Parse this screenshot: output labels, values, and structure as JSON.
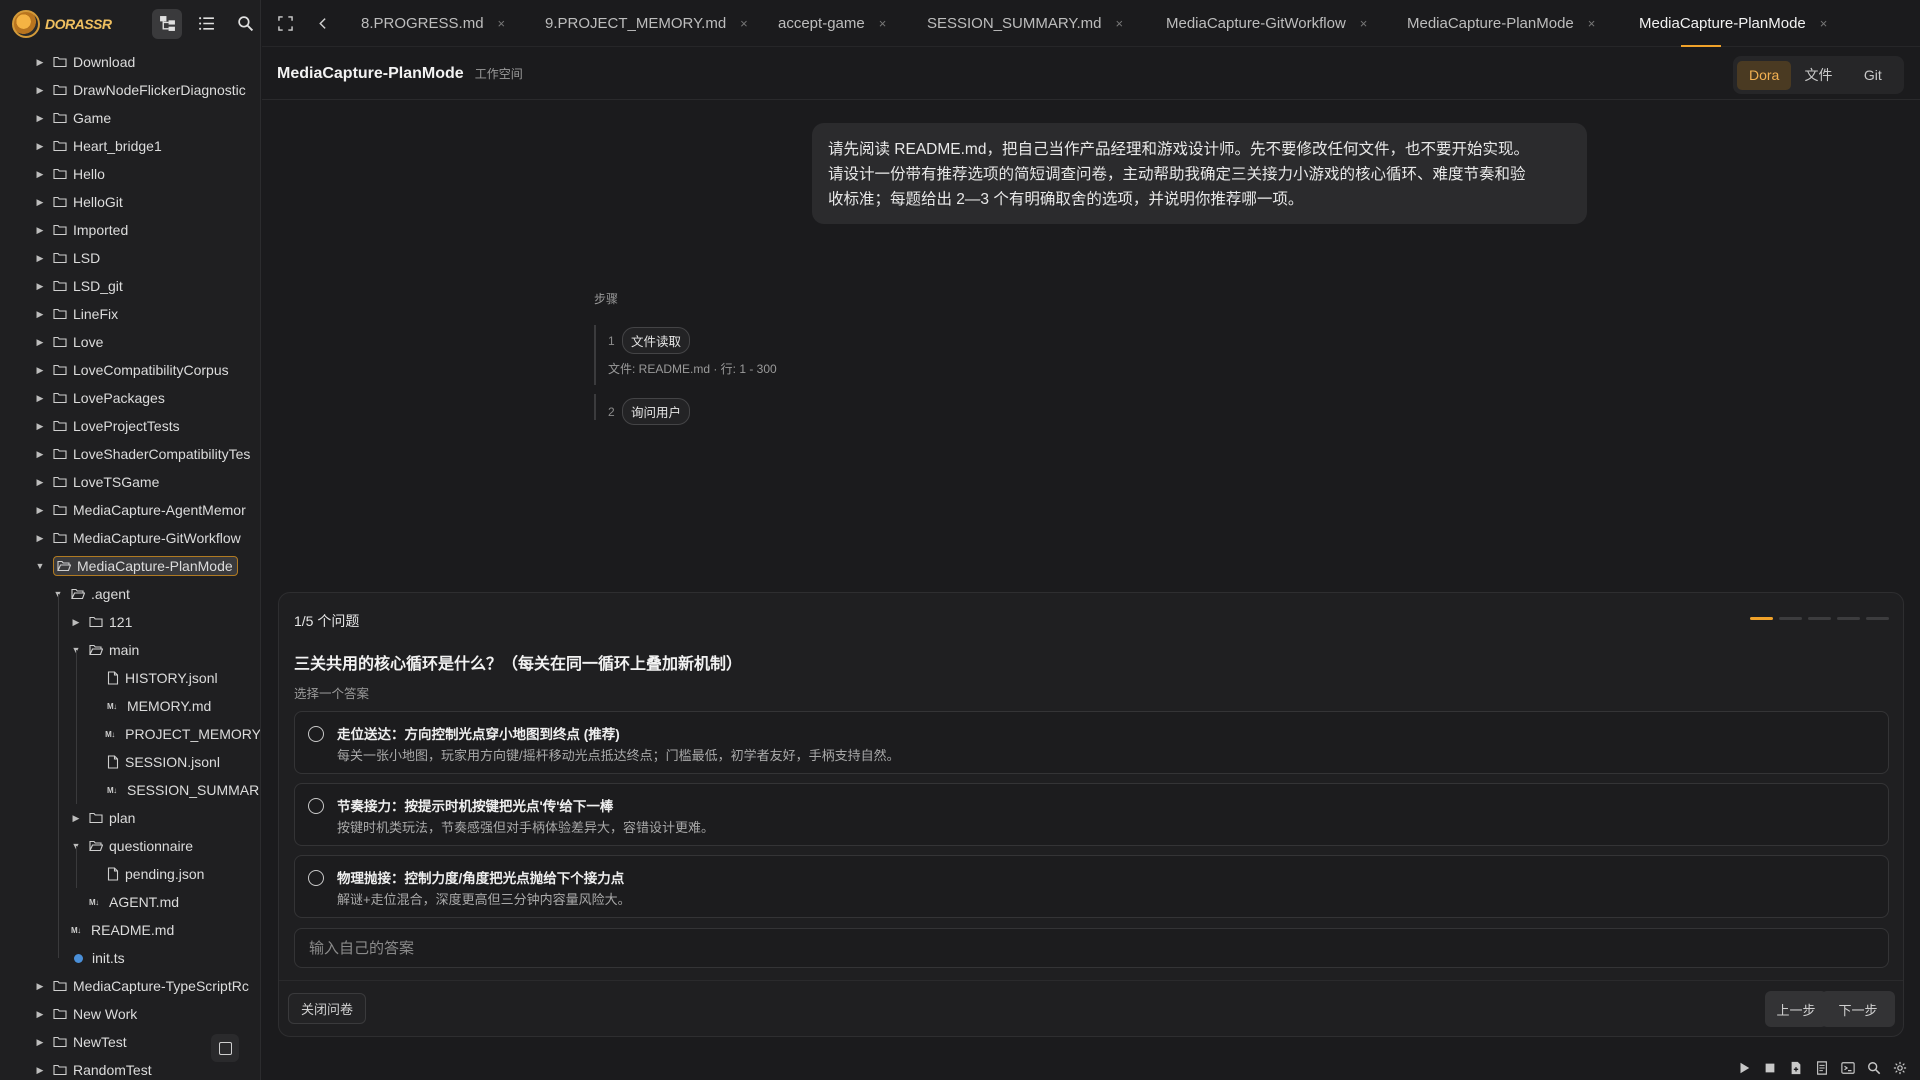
{
  "app": {
    "name": "DORASSR"
  },
  "sidebar": {
    "tree": [
      {
        "label": "Download"
      },
      {
        "label": "DrawNodeFlickerDiagnostic"
      },
      {
        "label": "Game"
      },
      {
        "label": "Heart_bridge1"
      },
      {
        "label": "Hello"
      },
      {
        "label": "HelloGit"
      },
      {
        "label": "Imported"
      },
      {
        "label": "LSD"
      },
      {
        "label": "LSD_git"
      },
      {
        "label": "LineFix"
      },
      {
        "label": "Love"
      },
      {
        "label": "LoveCompatibilityCorpus"
      },
      {
        "label": "LovePackages"
      },
      {
        "label": "LoveProjectTests"
      },
      {
        "label": "LoveShaderCompatibilityTes"
      },
      {
        "label": "LoveTSGame"
      },
      {
        "label": "MediaCapture-AgentMemor"
      },
      {
        "label": "MediaCapture-GitWorkflow"
      },
      {
        "label": "MediaCapture-PlanMode"
      },
      {
        "label": ".agent"
      },
      {
        "label": "121"
      },
      {
        "label": "main"
      },
      {
        "label": "HISTORY.jsonl"
      },
      {
        "label": "MEMORY.md"
      },
      {
        "label": "PROJECT_MEMORY"
      },
      {
        "label": "SESSION.jsonl"
      },
      {
        "label": "SESSION_SUMMAR"
      },
      {
        "label": "plan"
      },
      {
        "label": "questionnaire"
      },
      {
        "label": "pending.json"
      },
      {
        "label": "AGENT.md"
      },
      {
        "label": "README.md"
      },
      {
        "label": "init.ts"
      },
      {
        "label": "MediaCapture-TypeScriptRc"
      },
      {
        "label": "New Work"
      },
      {
        "label": "NewTest"
      },
      {
        "label": "RandomTest"
      }
    ]
  },
  "tabs": [
    {
      "label": "8.PROGRESS.md"
    },
    {
      "label": "9.PROJECT_MEMORY.md"
    },
    {
      "label": "accept-game"
    },
    {
      "label": "SESSION_SUMMARY.md"
    },
    {
      "label": "MediaCapture-GitWorkflow"
    },
    {
      "label": "MediaCapture-PlanMode"
    },
    {
      "label": "MediaCapture-PlanMode"
    }
  ],
  "tab_close": "×",
  "workspace": {
    "title": "MediaCapture-PlanMode",
    "subtitle": "工作空间",
    "segments": [
      "Dora",
      "文件",
      "Git"
    ]
  },
  "chat": {
    "user_message_lines": [
      "请先阅读 README.md，把自己当作产品经理和游戏设计师。先不要修改任何文件，也不要开始实现。",
      "请设计一份带有推荐选项的简短调查问卷，主动帮助我确定三关接力小游戏的核心循环、难度节奏和验",
      "收标准；每题给出 2—3 个有明确取舍的选项，并说明你推荐哪一项。"
    ],
    "steps_label": "步骤",
    "steps": [
      {
        "num": "1",
        "label": "文件读取",
        "detail": "文件: README.md · 行: 1 - 300"
      },
      {
        "num": "2",
        "label": "询问用户"
      }
    ]
  },
  "questionnaire": {
    "count": "1/5 个问题",
    "progress": {
      "current": 1,
      "total": 5
    },
    "question": "三关共用的核心循环是什么？（每关在同一循环上叠加新机制）",
    "hint": "选择一个答案",
    "options": [
      {
        "title": "走位送达：方向控制光点穿小地图到终点 (推荐)",
        "desc": "每关一张小地图，玩家用方向键/摇杆移动光点抵达终点；门槛最低，初学者友好，手柄支持自然。"
      },
      {
        "title": "节奏接力：按提示时机按键把光点'传'给下一棒",
        "desc": "按键时机类玩法，节奏感强但对手柄体验差异大，容错设计更难。"
      },
      {
        "title": "物理抛接：控制力度/角度把光点抛给下个接力点",
        "desc": "解谜+走位混合，深度更高但三分钟内容量风险大。"
      }
    ],
    "custom_placeholder": "输入自己的答案",
    "close_label": "关闭问卷",
    "prev_label": "上一步",
    "next_label": "下一步"
  },
  "colors": {
    "accent": "#f0a22a"
  }
}
